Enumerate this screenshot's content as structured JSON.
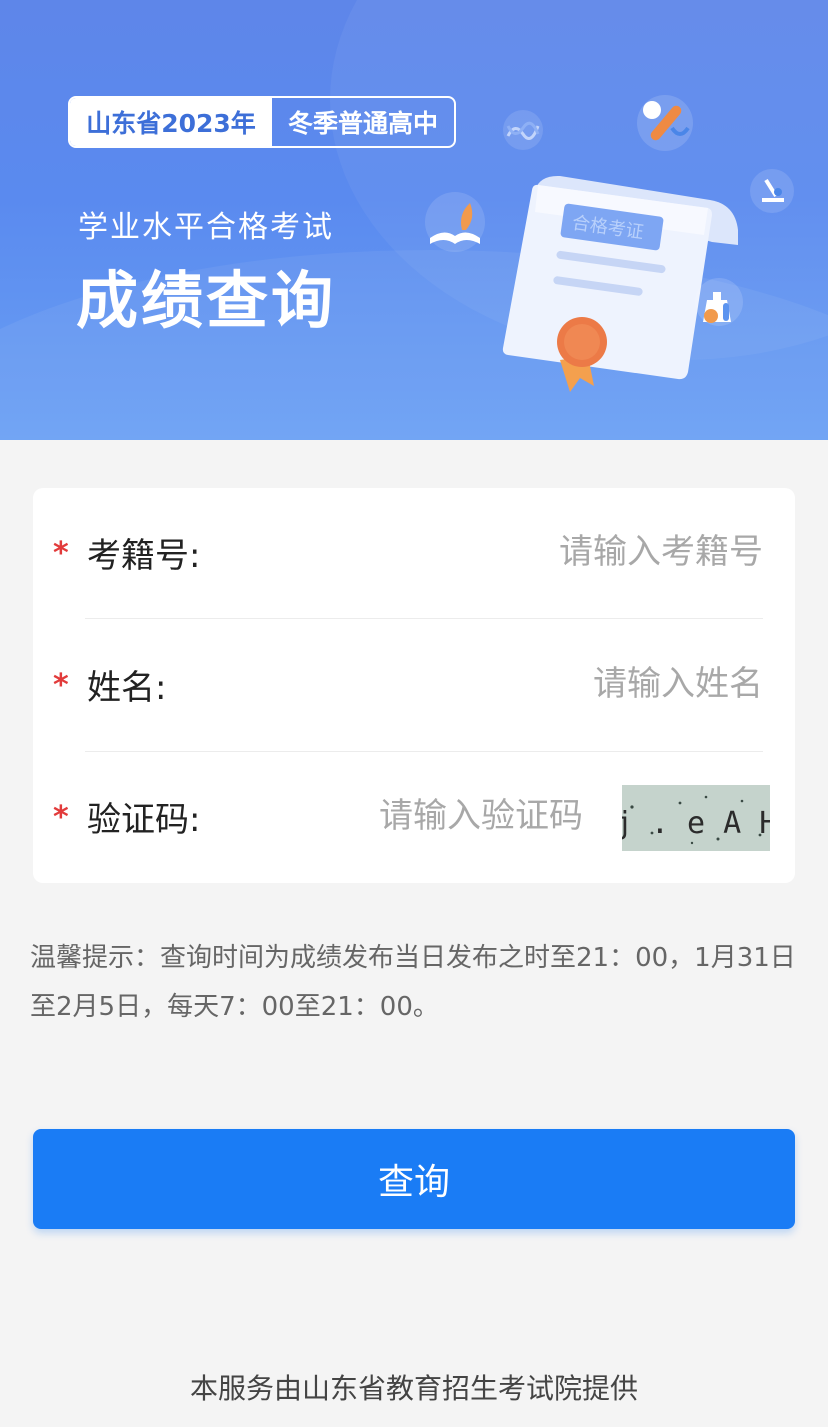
{
  "banner": {
    "tag_left": "山东省2023年",
    "tag_right": "冬季普通高中",
    "subtitle": "学业水平合格考试",
    "title": "成绩查询",
    "certificate_text": "合格考证"
  },
  "form": {
    "required_mark": "*",
    "exam_id": {
      "label": "考籍号:",
      "placeholder": "请输入考籍号",
      "value": ""
    },
    "name": {
      "label": "姓名:",
      "placeholder": "请输入姓名",
      "value": ""
    },
    "captcha": {
      "label": "验证码:",
      "placeholder": "请输入验证码",
      "value": "",
      "image_text": "j . e A H"
    }
  },
  "tip": "温馨提示：查询时间为成绩发布当日发布之时至21：00，1月31日至2月5日，每天7：00至21：00。",
  "submit_label": "查询",
  "footer": "本服务由山东省教育招生考试院提供",
  "colors": {
    "banner": "#5e86e9",
    "primary_button": "#1a7cf5",
    "required": "#e23b3b",
    "background": "#f4f4f4"
  }
}
